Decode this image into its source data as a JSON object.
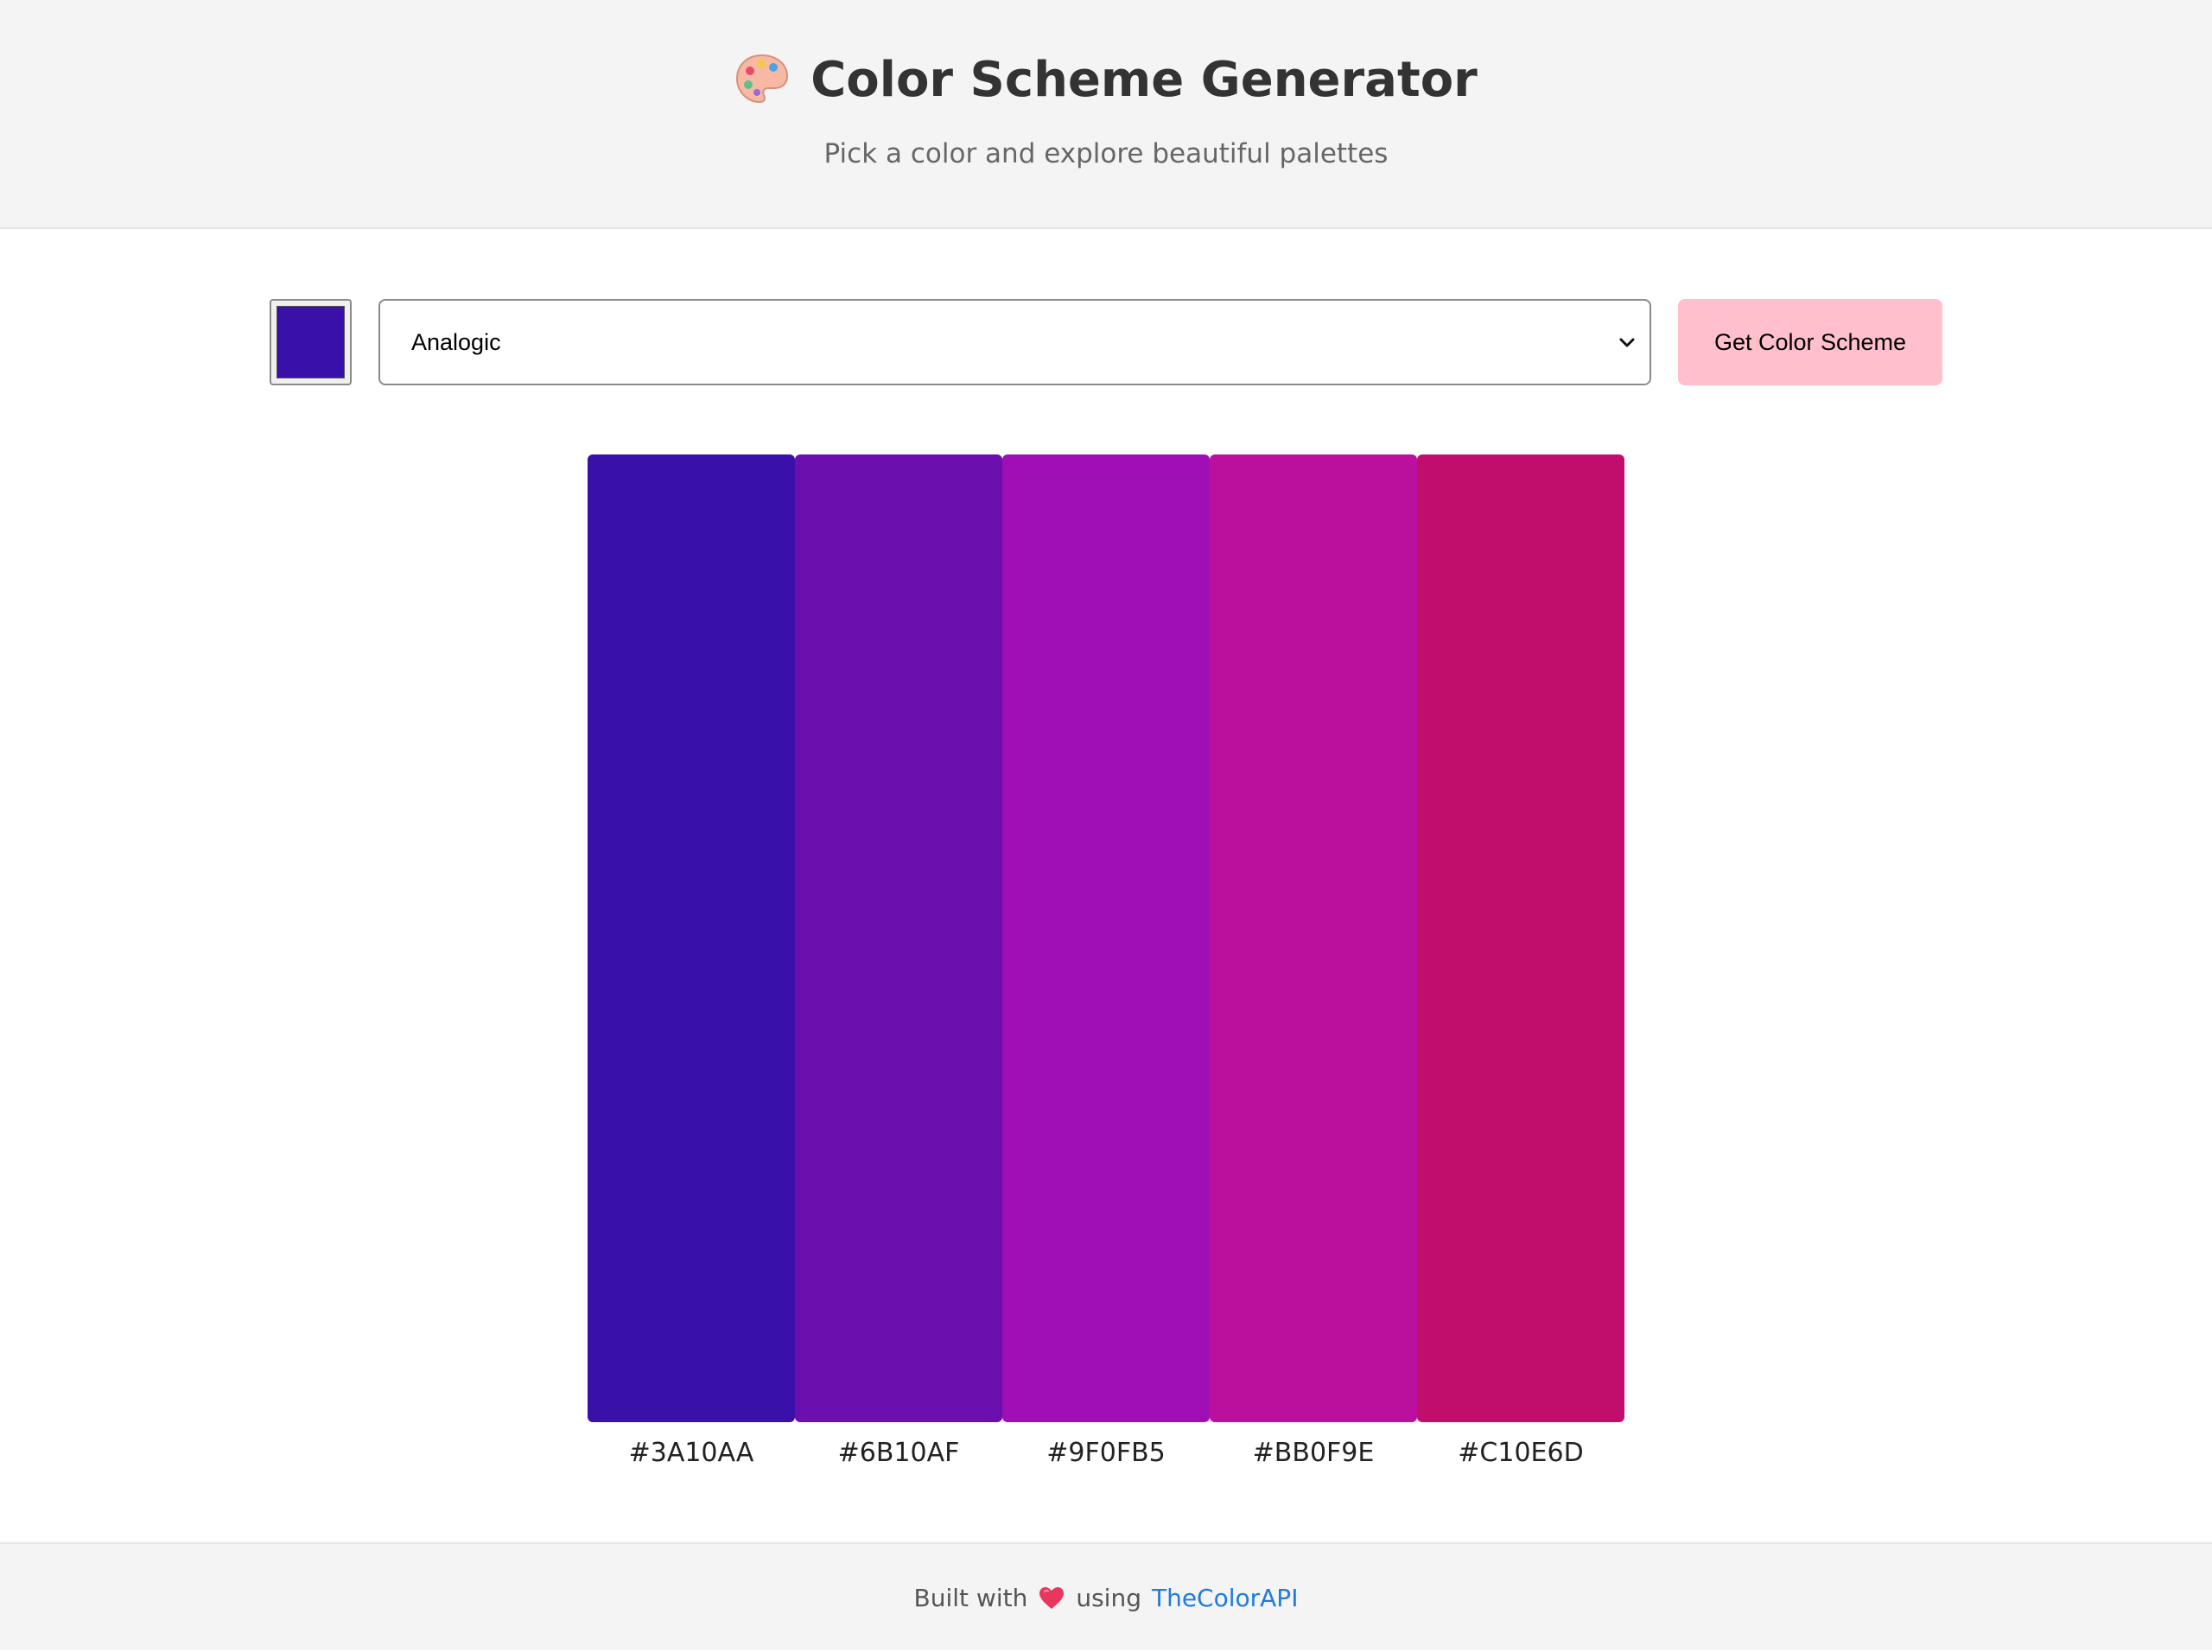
{
  "header": {
    "title": "Color Scheme Generator",
    "subtitle": "Pick a color and explore beautiful palettes",
    "icon": "palette-icon"
  },
  "controls": {
    "color_value": "#3A10AA",
    "scheme_selected": "Analogic",
    "button_label": "Get Color Scheme",
    "button_color": "#ffc0cb"
  },
  "palette": {
    "colors": [
      {
        "hex": "#3A10AA"
      },
      {
        "hex": "#6B10AF"
      },
      {
        "hex": "#9F0FB5"
      },
      {
        "hex": "#BB0F9E"
      },
      {
        "hex": "#C10E6D"
      }
    ]
  },
  "footer": {
    "built_with": "Built with",
    "heart_icon": "heart-icon",
    "using": "using",
    "link_text": "TheColorAPI",
    "link_color": "#1e7be0"
  }
}
